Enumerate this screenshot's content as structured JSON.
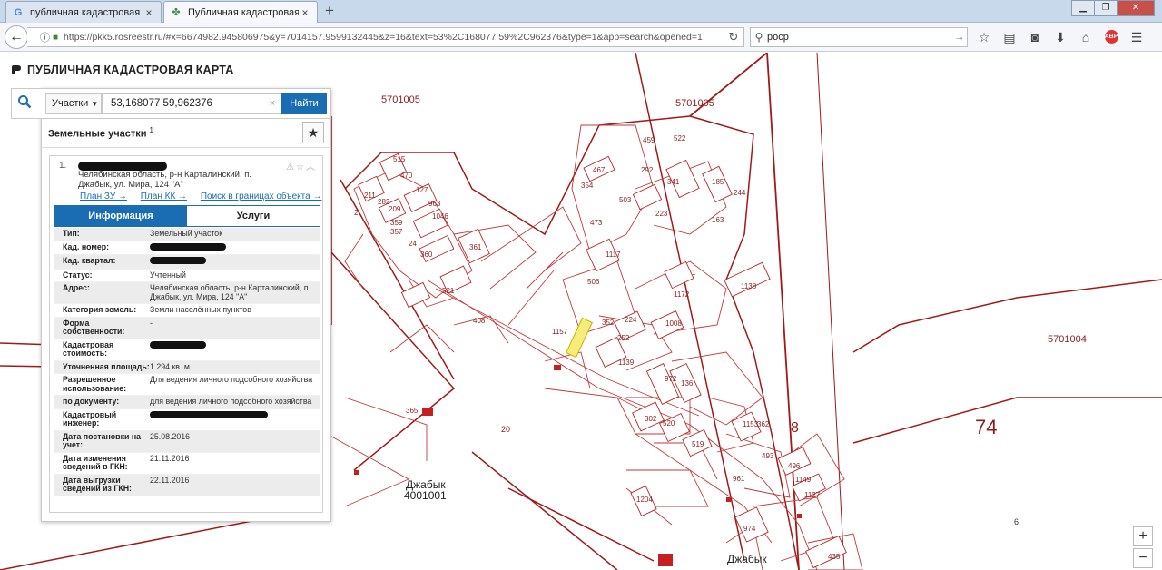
{
  "browser": {
    "tabs": [
      {
        "label": "публичная кадастровая к...",
        "favicon": "G"
      },
      {
        "label": "Публичная кадастровая к...",
        "favicon": "✤"
      }
    ],
    "new_tab": "+",
    "url": "https://pkk5.rosreestr.ru/#x=6674982.945806975&y=7014157.9599132445&z=16&text=53%2C168077 59%2C962376&type=1&app=search&opened=1",
    "search_value": "роср",
    "abp": "ABP"
  },
  "app": {
    "title": "ПУБЛИЧНАЯ КАДАСТРОВАЯ КАРТА",
    "search": {
      "type": "Участки",
      "value": "53,168077 59,962376",
      "button": "Найти"
    },
    "section_title": "Земельные участки",
    "section_count": "1",
    "result": {
      "index": "1.",
      "address_short": "Челябинская область, р-н Карталинский, п. Джабык, ул. Мира, 124 \"А\"",
      "links": [
        "План ЗУ →",
        "План КК →",
        "Поиск в границах объекта →"
      ],
      "tabs": [
        "Информация",
        "Услуги"
      ],
      "rows": [
        {
          "k": "Тип:",
          "v": "Земельный участок"
        },
        {
          "k": "Кад. номер:",
          "v": "",
          "redacted": 84
        },
        {
          "k": "Кад. квартал:",
          "v": "",
          "redacted": 62
        },
        {
          "k": "Статус:",
          "v": "Учтенный"
        },
        {
          "k": "Адрес:",
          "v": "Челябинская область, р-н Карталинский, п. Джабык, ул. Мира, 124 \"А\""
        },
        {
          "k": "Категория земель:",
          "v": "Земли населённых пунктов"
        },
        {
          "k": "Форма собственности:",
          "v": "-"
        },
        {
          "k": "Кадастровая стоимость:",
          "v": "",
          "redacted": 62
        },
        {
          "k": "Уточненная площадь:",
          "v": "1 294 кв. м"
        },
        {
          "k": "Разрешенное использование:",
          "v": "Для ведения личного подсобного хозяйства"
        },
        {
          "k": "по документу:",
          "v": "для ведения личного подсобного хозяйства"
        },
        {
          "k": "Кадастровый инженер:",
          "v": "",
          "redacted": 130
        },
        {
          "k": "Дата постановки на учет:",
          "v": "25.08.2016"
        },
        {
          "k": "Дата изменения сведений в ГКН:",
          "v": "21.11.2016"
        },
        {
          "k": "Дата выгрузки сведений из ГКН:",
          "v": "22.11.2016"
        }
      ]
    }
  },
  "map": {
    "labels_big": [
      "5701005",
      "5701005",
      "5701004",
      "74",
      "8",
      "20",
      "6"
    ],
    "place_labels": [
      "Джабык",
      "4001001",
      "Джабык"
    ],
    "parcels": [
      "515",
      "211",
      "282",
      "470",
      "209",
      "127",
      "359",
      "357",
      "963",
      "1046",
      "24",
      "360",
      "361",
      "354",
      "467",
      "459",
      "522",
      "292",
      "341",
      "185",
      "244",
      "503",
      "473",
      "223",
      "163",
      "1117",
      "506",
      "1",
      "1172",
      "1138",
      "1008",
      "224",
      "352",
      "252",
      "1157",
      "1139",
      "972",
      "136",
      "521",
      "408",
      "365",
      "302",
      "520",
      "519",
      "961",
      "1204",
      "1153",
      "362",
      "493",
      "496",
      "1149",
      "1127",
      "974",
      "435",
      "2"
    ],
    "zoom_in": "+",
    "zoom_out": "−"
  }
}
